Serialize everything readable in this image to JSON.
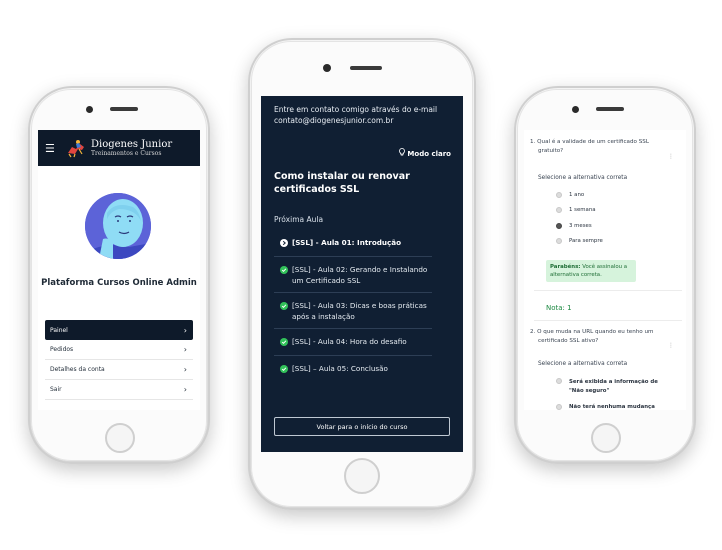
{
  "colors": {
    "navy": "#0e1a2a",
    "success": "#1e8a43",
    "success_bg": "#d6f3dc"
  },
  "phone1": {
    "logo": {
      "line1": "Diogenes Junior",
      "line2": "Treinamentos e Cursos"
    },
    "menu_icon": "hamburger-icon",
    "profile_title": "Plataforma Cursos Online Admin",
    "menu": [
      {
        "label": "Painel",
        "active": true
      },
      {
        "label": "Pedidos",
        "active": false
      },
      {
        "label": "Detalhes da conta",
        "active": false
      },
      {
        "label": "Sair",
        "active": false
      }
    ]
  },
  "phone2": {
    "contact_line1": "Entre em contato comigo através do e-mail",
    "contact_line2": "contato@diogenesjunior.com.br",
    "mode_label": "Modo claro",
    "course_title": "Como instalar ou renovar certificados SSL",
    "next_label": "Próxima Aula",
    "lessons": [
      {
        "title": "[SSL] - Aula 01: Introdução",
        "state": "current"
      },
      {
        "title": "[SSL] - Aula 02: Gerando e Instalando um Certificado SSL",
        "state": "done"
      },
      {
        "title": "[SSL] - Aula 03: Dicas e boas práticas após a instalação",
        "state": "done"
      },
      {
        "title": "[SSL] - Aula 04: Hora do desafio",
        "state": "done"
      },
      {
        "title": "[SSL] – Aula 05: Conclusão",
        "state": "done"
      }
    ],
    "back_button": "Voltar para o início do curso"
  },
  "phone3": {
    "q1_num": "1.",
    "q1_line1": "Qual é a validade de um certificado SSL",
    "q1_line2": "gratuito?",
    "q1_instruction": "Selecione a alternativa correta",
    "q1_options": [
      {
        "label": "1 ano",
        "selected": false
      },
      {
        "label": "1 semana",
        "selected": false
      },
      {
        "label": "3 meses",
        "selected": true
      },
      {
        "label": "Para sempre",
        "selected": false
      }
    ],
    "feedback_strong": "Parabéns:",
    "feedback_text1": "Você assinalou a",
    "feedback_text2": "alternativa correta.",
    "score": "Nota: 1",
    "q2_num": "2.",
    "q2_line1": "O que muda na URL quando eu tenho um",
    "q2_line2": "certificado SSL ativo?",
    "q2_instruction": "Selecione a alternativa correta",
    "q2_options": [
      {
        "line1": "Será exibida a informação de",
        "line2": "\"Não seguro\""
      },
      {
        "line1": "Não terá nenhuma mudança",
        "line2": ""
      }
    ]
  }
}
